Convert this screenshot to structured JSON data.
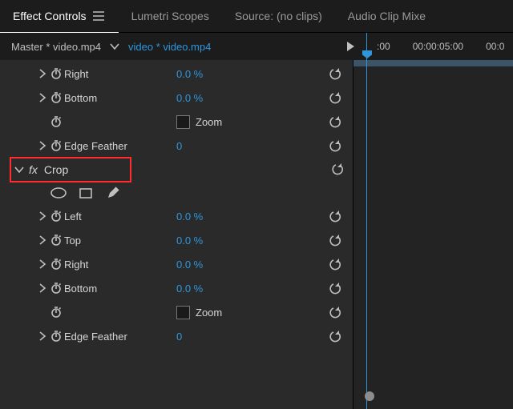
{
  "tabs": {
    "effect_controls": "Effect Controls",
    "lumetri_scopes": "Lumetri Scopes",
    "source": "Source: (no clips)",
    "audio_mixer": "Audio Clip Mixe"
  },
  "header": {
    "master": "Master * video.mp4",
    "clip": "video * video.mp4",
    "time_start": ":00",
    "time_mid": "00:00:05:00",
    "time_end": "00:0"
  },
  "params_upper": {
    "right": {
      "name": "Right",
      "value": "0.0 %"
    },
    "bottom": {
      "name": "Bottom",
      "value": "0.0 %"
    },
    "zoom": {
      "name": "Zoom"
    },
    "edge_feather": {
      "name": "Edge Feather",
      "value": "0"
    }
  },
  "crop": {
    "section": "Crop",
    "left": {
      "name": "Left",
      "value": "0.0 %"
    },
    "top": {
      "name": "Top",
      "value": "0.0 %"
    },
    "right": {
      "name": "Right",
      "value": "0.0 %"
    },
    "bottom": {
      "name": "Bottom",
      "value": "0.0 %"
    },
    "zoom": {
      "name": "Zoom"
    },
    "edge_feather": {
      "name": "Edge Feather",
      "value": "0"
    }
  }
}
